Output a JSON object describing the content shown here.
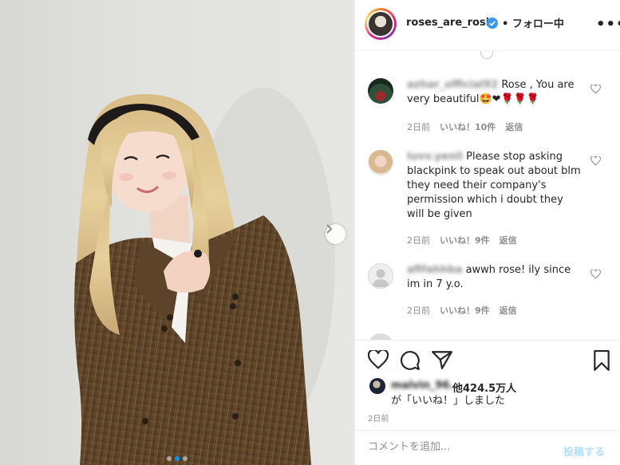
{
  "header": {
    "username": "roses_are_rosie",
    "separator": "•",
    "follow_label": "フォロー中",
    "more_label": "•••"
  },
  "carousel": {
    "slide_count": 3,
    "active_slide": 2
  },
  "comments": [
    {
      "username": "azhar_official92",
      "text": "Rose , You are very beautiful🤩❤🌹🌹🌹",
      "time": "2日前",
      "likes": "いいね！10件",
      "reply": "返信"
    },
    {
      "username": "luvv.yenii",
      "text": "Please stop asking blackpink to speak out about blm they need their company's permission which i doubt they will be given",
      "time": "2日前",
      "likes": "いいね！9件",
      "reply": "返信"
    },
    {
      "username": "afifahhba",
      "text": "awwh rose! ily since im in 7 y.o.",
      "time": "2日前",
      "likes": "いいね！9件",
      "reply": "返信"
    }
  ],
  "likes": {
    "liker": "malvin_96.",
    "others": "他424.5万人",
    "suffix": "が「いいね！」しました"
  },
  "post_time": "2日前",
  "add_comment": {
    "placeholder": "コメントを追加...",
    "post_label": "投稿する"
  },
  "colors": {
    "accent": "#0095f6",
    "verified": "#3897f0",
    "muted_text": "#8e8e8e",
    "disabled_post": "#b2dffc"
  }
}
